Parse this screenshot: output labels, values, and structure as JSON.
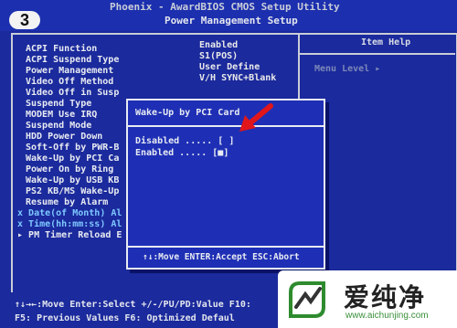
{
  "header": {
    "line1": "Phoenix - AwardBIOS CMOS Setup Utility",
    "line2": "Power Management Setup",
    "badge": "3"
  },
  "help": {
    "title": "Item Help",
    "menu_level": "Menu Level ▸"
  },
  "settings": [
    {
      "label": "ACPI Function",
      "value": "Enabled"
    },
    {
      "label": "ACPI Suspend Type",
      "value": "S1(POS)"
    },
    {
      "label": "Power Management",
      "value": "User Define"
    },
    {
      "label": "Video Off Method",
      "value": "V/H SYNC+Blank"
    },
    {
      "label": "Video Off in Susp",
      "value": ""
    },
    {
      "label": "Suspend Type",
      "value": ""
    },
    {
      "label": "MODEM Use IRQ",
      "value": ""
    },
    {
      "label": "Suspend Mode",
      "value": ""
    },
    {
      "label": "HDD Power Down",
      "value": ""
    },
    {
      "label": "Soft-Off by PWR-B",
      "value": ""
    },
    {
      "label": "Wake-Up by PCI Ca",
      "value": ""
    },
    {
      "label": "Power On by Ring",
      "value": ""
    },
    {
      "label": "Wake-Up by USB KB",
      "value": ""
    },
    {
      "label": "PS2 KB/MS Wake-Up",
      "value": ""
    },
    {
      "label": "Resume by Alarm",
      "value": ""
    },
    {
      "label": "Date(of Month) Al",
      "value": ""
    },
    {
      "label": "Time(hh:mm:ss) Al",
      "value": ""
    },
    {
      "label": "PM Timer Reload E",
      "value": ""
    }
  ],
  "popup": {
    "title": "Wake-Up by PCI Card",
    "options": [
      {
        "label": "Disabled ..... [ ]"
      },
      {
        "label": "Enabled  ..... [■]"
      }
    ],
    "footer": "↑↓:Move ENTER:Accept ESC:Abort"
  },
  "footer": {
    "line1": "↑↓→←:Move  Enter:Select  +/-/PU/PD:Value  F10:",
    "line2": "F5: Previous Values    F6: Optimized Defaul"
  },
  "watermark": {
    "text": "爱纯净",
    "url": "www.aichunjing.com"
  },
  "colors": {
    "bios_blue": "#1b2a9c",
    "highlight": "#7ec8ff",
    "arrow_red": "#e0161b",
    "watermark_green": "#3a8f3a"
  }
}
